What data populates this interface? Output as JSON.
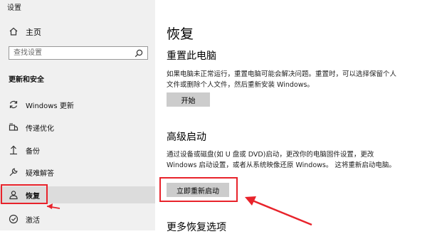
{
  "window": {
    "title": "设置"
  },
  "sidebar": {
    "home_label": "主页",
    "search_placeholder": "查找设置",
    "section_title": "更新和安全",
    "items": [
      {
        "label": "Windows 更新",
        "icon": "sync-icon",
        "active": false
      },
      {
        "label": "传递优化",
        "icon": "delivery-optimization-icon",
        "active": false
      },
      {
        "label": "备份",
        "icon": "backup-arrow-icon",
        "active": false
      },
      {
        "label": "疑难解答",
        "icon": "wrench-icon",
        "active": false
      },
      {
        "label": "恢复",
        "icon": "recovery-user-icon",
        "active": true
      },
      {
        "label": "激活",
        "icon": "activation-check-icon",
        "active": false
      }
    ]
  },
  "main": {
    "title": "恢复",
    "reset": {
      "heading": "重置此电脑",
      "description": "如果电脑未正常运行，重置电脑可能会解决问题。重置时，可以选择保留个人文件或删除个人文件，然后重新安装 Windows。",
      "button_label": "开始"
    },
    "advanced": {
      "heading": "高级启动",
      "description": "通过设备或磁盘(如 U 盘或 DVD)启动，更改你的电脑固件设置，更改 Windows 启动设置，或者从系统映像还原 Windows。 这将重新启动电脑。",
      "button_label": "立即重新启动"
    },
    "more": {
      "heading": "更多恢复选项"
    }
  },
  "colors": {
    "highlight": "#e8232b",
    "sidebar_bg": "#f0f0f0",
    "button_bg": "#cccccc"
  }
}
